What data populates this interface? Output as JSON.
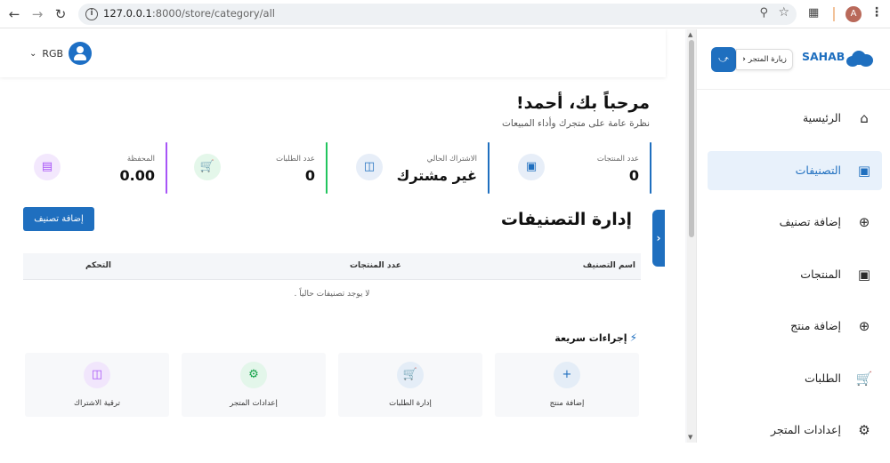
{
  "browser": {
    "url_host": "127.0.0.1",
    "url_path": ":8000/store/category/all",
    "profile_initial": "A"
  },
  "topbar": {
    "user_name": "RGB"
  },
  "welcome": {
    "title": "مرحباً بك، أحمد!",
    "subtitle": "نظرة عامة على متجرك وأداء المبيعات"
  },
  "stats": [
    {
      "label": "عدد المنتجات",
      "value": "0",
      "color": "#1f6fbf",
      "icon": "box-icon"
    },
    {
      "label": "الاشتراك الحالي",
      "value": "غير مشترك",
      "color": "#1f6fbf",
      "icon": "id-card-icon"
    },
    {
      "label": "عدد الطلبات",
      "value": "0",
      "color": "#22c55e",
      "icon": "cart-icon"
    },
    {
      "label": "المحفظة",
      "value": "0.00",
      "color": "#a855f7",
      "icon": "wallet-icon"
    }
  ],
  "categories": {
    "title": "إدارة التصنيفات",
    "add_button": "إضافة تصنيف",
    "columns": [
      "اسم التصنيف",
      "عدد المنتجات",
      "التحكم"
    ],
    "empty_message": "لا يوجد تصنيفات حالياً ."
  },
  "quick_actions": {
    "title": "إجراءات سريعة",
    "items": [
      {
        "label": "إضافة منتج",
        "icon": "plus-icon"
      },
      {
        "label": "إدارة الطلبات",
        "icon": "cart-icon"
      },
      {
        "label": "إعدادات المتجر",
        "icon": "gear-icon"
      },
      {
        "label": "ترقية الاشتراك",
        "icon": "id-card-icon"
      }
    ]
  },
  "sidebar": {
    "brand": "SAHAB",
    "visit_store": "زيارة المتجر",
    "items": [
      {
        "label": "الرئيسية",
        "icon": "home-icon",
        "active": false
      },
      {
        "label": "التصنيفات",
        "icon": "bag-icon",
        "active": true
      },
      {
        "label": "إضافة تصنيف",
        "icon": "plus-circle-icon",
        "active": false
      },
      {
        "label": "المنتجات",
        "icon": "bag-icon",
        "active": false
      },
      {
        "label": "إضافة منتج",
        "icon": "plus-circle-icon",
        "active": false
      },
      {
        "label": "الطلبات",
        "icon": "cart-icon",
        "active": false
      },
      {
        "label": "إعدادات المتجر",
        "icon": "gear-icon",
        "active": false
      }
    ]
  }
}
